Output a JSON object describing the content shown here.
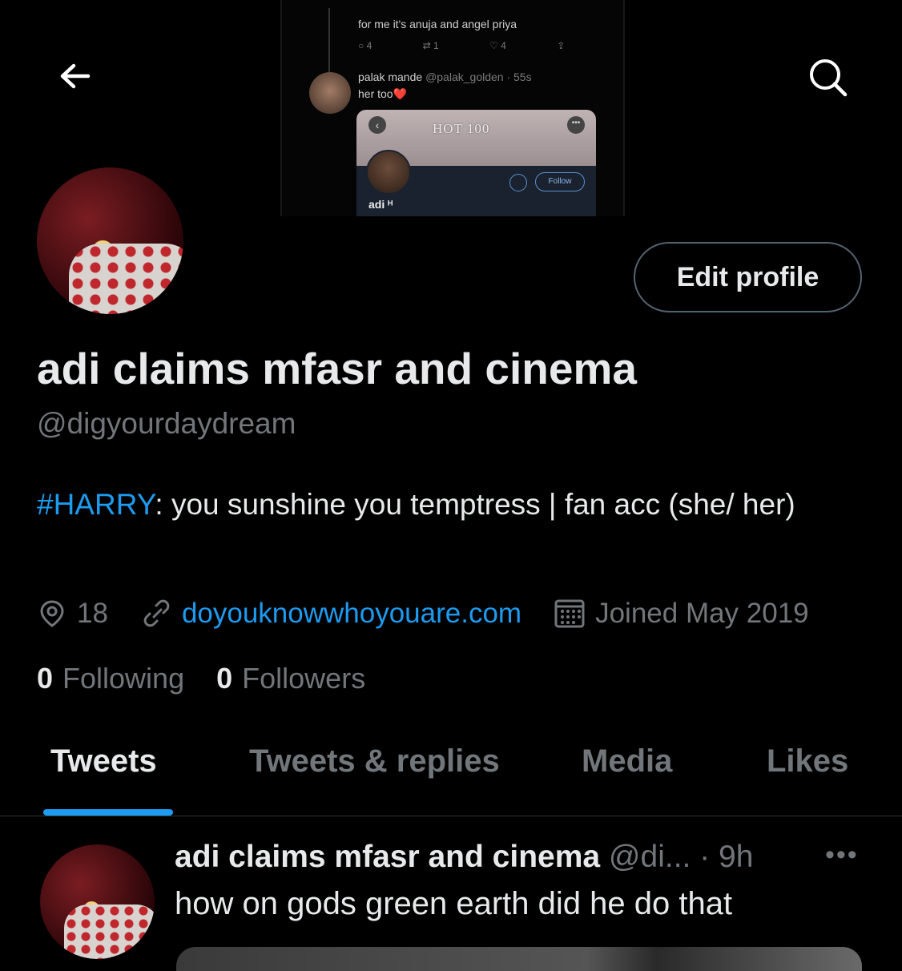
{
  "banner": {
    "reply_text": "for me it's anuja and angel priya",
    "reply_stats": {
      "replies": "4",
      "retweets": "1",
      "likes": "4"
    },
    "reply2_name": "palak mande",
    "reply2_handle": "@palak_golden · 55s",
    "reply2_text": "her too❤️",
    "card_title": "HOT 100",
    "card_follow": "Follow",
    "card_name": "adi ᴴ"
  },
  "profile": {
    "display_name": "adi claims mfasr and cinema",
    "handle": "@digyourdaydream",
    "bio_hashtag": "#HARRY",
    "bio_text": ": you sunshine you temptress | fan acc (she/ her)",
    "location": "18",
    "website": "doyouknowwhoyouare.com",
    "joined": "Joined May 2019",
    "following_count": "0",
    "following_label": "Following",
    "followers_count": "0",
    "followers_label": "Followers",
    "edit_profile_label": "Edit profile"
  },
  "tabs": [
    {
      "label": "Tweets",
      "active": true
    },
    {
      "label": "Tweets & replies",
      "active": false
    },
    {
      "label": "Media",
      "active": false
    },
    {
      "label": "Likes",
      "active": false
    }
  ],
  "tweet": {
    "name": "adi claims mfasr and cinema",
    "handle_time": "@di... · 9h",
    "more": "•••",
    "text": "how on gods green earth did he do that"
  },
  "icons": {
    "back": "arrow-left-icon",
    "search": "search-icon",
    "location": "location-pin-icon",
    "link": "link-icon",
    "calendar": "calendar-icon"
  },
  "colors": {
    "accent": "#1d9bf0",
    "muted": "#71767b",
    "text": "#e7e9ea",
    "background": "#000000"
  }
}
